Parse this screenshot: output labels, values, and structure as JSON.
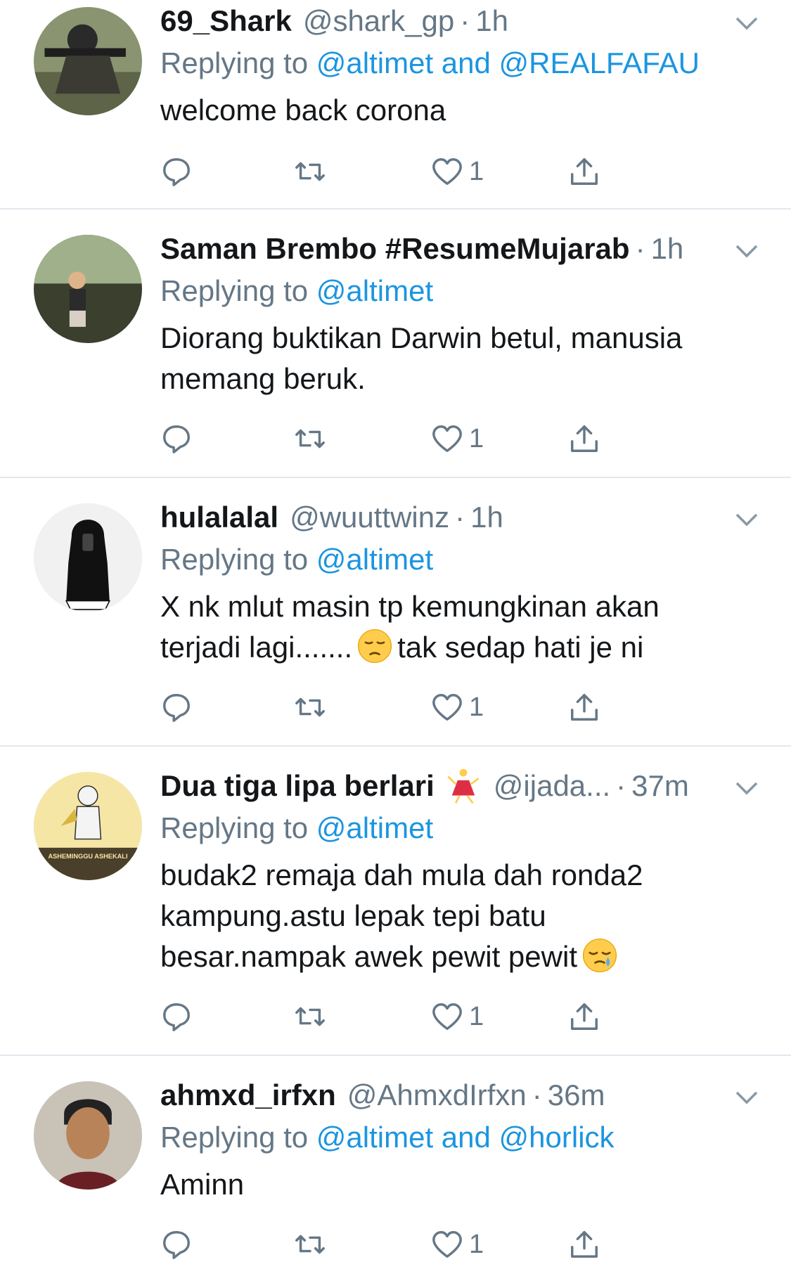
{
  "tweets": [
    {
      "display_name": "69_Shark",
      "handle": "@shark_gp",
      "time": "1h",
      "reply_prefix": "Replying to",
      "reply_to": "@altimet and @REALFAFAU",
      "text_lines": [
        "welcome back corona"
      ],
      "likes": "1"
    },
    {
      "display_name": "Saman Brembo #ResumeMujarab",
      "handle": "",
      "time": "1h",
      "reply_prefix": "Replying to",
      "reply_to": "@altimet",
      "text_lines": [
        "Diorang buktikan Darwin betul, manusia",
        "memang beruk."
      ],
      "likes": "1"
    },
    {
      "display_name": "hulalalal",
      "handle": "@wuuttwinz",
      "time": "1h",
      "reply_prefix": "Replying to",
      "reply_to": "@altimet",
      "text_lines": [
        "X nk mlut masin tp kemungkinan akan"
      ],
      "text_line2_a": "terjadi lagi.......",
      "text_line2_b": "tak sedap hati je ni",
      "likes": "1"
    },
    {
      "display_name": "Dua tiga lipa berlari",
      "handle": "@ijada...",
      "time": "37m",
      "reply_prefix": "Replying to",
      "reply_to": "@altimet",
      "text_lines": [
        "budak2 remaja dah mula dah ronda2",
        "kampung.astu lepak tepi batu"
      ],
      "text_line3": "besar.nampak awek pewit pewit",
      "likes": "1"
    },
    {
      "display_name": "ahmxd_irfxn",
      "handle": "@AhmxdIrfxn",
      "time": "36m",
      "reply_prefix": "Replying to",
      "reply_to": "@altimet and @horlick",
      "text_lines": [
        "Aminn"
      ],
      "likes": "1"
    }
  ],
  "separator": "·",
  "icons": [
    "reply-icon",
    "retweet-icon",
    "like-icon",
    "share-icon",
    "chevron-down-icon",
    "pensive-face-emoji",
    "sleepy-face-emoji",
    "dancer-emoji"
  ],
  "avatar_labels": {
    "tweet4": "ASHEMINGGU ASHEKALI"
  },
  "colors": {
    "link": "#1b95e0",
    "muted": "#657786",
    "text": "#14171a",
    "divider": "#e1e8ed"
  }
}
